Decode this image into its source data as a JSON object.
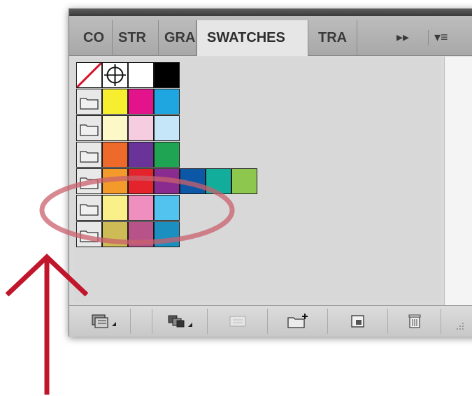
{
  "panel": {
    "tabs": [
      {
        "label": "CO",
        "active": false
      },
      {
        "label": "STR",
        "active": false
      },
      {
        "label": "GRA",
        "active": false
      },
      {
        "label": "SWATCHES",
        "active": true
      },
      {
        "label": "TRA",
        "active": false
      }
    ],
    "expand_glyph": "▸▸",
    "menu_glyph": "▾≡"
  },
  "swatch_rows": [
    {
      "group": false,
      "colors": [
        "none",
        "registration",
        "#ffffff",
        "#000000"
      ]
    },
    {
      "group": true,
      "colors": [
        "#f6ee2f",
        "#e2138b",
        "#1fa6e0"
      ]
    },
    {
      "group": true,
      "colors": [
        "#fdf8c8",
        "#f6cde0",
        "#c5e6f8"
      ]
    },
    {
      "group": true,
      "colors": [
        "#ee6a2b",
        "#69339a",
        "#1fa454"
      ]
    },
    {
      "group": true,
      "colors": [
        "#f39a2a",
        "#e4232c",
        "#8a2b90",
        "#0d58a6",
        "#13ad9c",
        "#8ec74e"
      ]
    },
    {
      "group": true,
      "colors": [
        "#f9f08a",
        "#ef8fc0",
        "#52c3ee"
      ]
    },
    {
      "group": true,
      "colors": [
        "#cdbb56",
        "#b8538a",
        "#1a8fc0"
      ]
    }
  ],
  "bottom_buttons": [
    {
      "name": "swatch-libraries-menu-button",
      "icon": "swatch-libraries-icon"
    },
    {
      "name": "show-swatch-kinds-button",
      "icon": "show-kinds-icon"
    },
    {
      "name": "swatch-options-button",
      "icon": "swatch-options-icon"
    },
    {
      "name": "new-color-group-button",
      "icon": "new-folder-icon"
    },
    {
      "name": "new-swatch-button",
      "icon": "new-swatch-icon"
    },
    {
      "name": "delete-swatch-button",
      "icon": "trash-icon"
    }
  ],
  "colors": {
    "annotation": "#c0152b",
    "highlight_ellipse": "#c9606c"
  }
}
